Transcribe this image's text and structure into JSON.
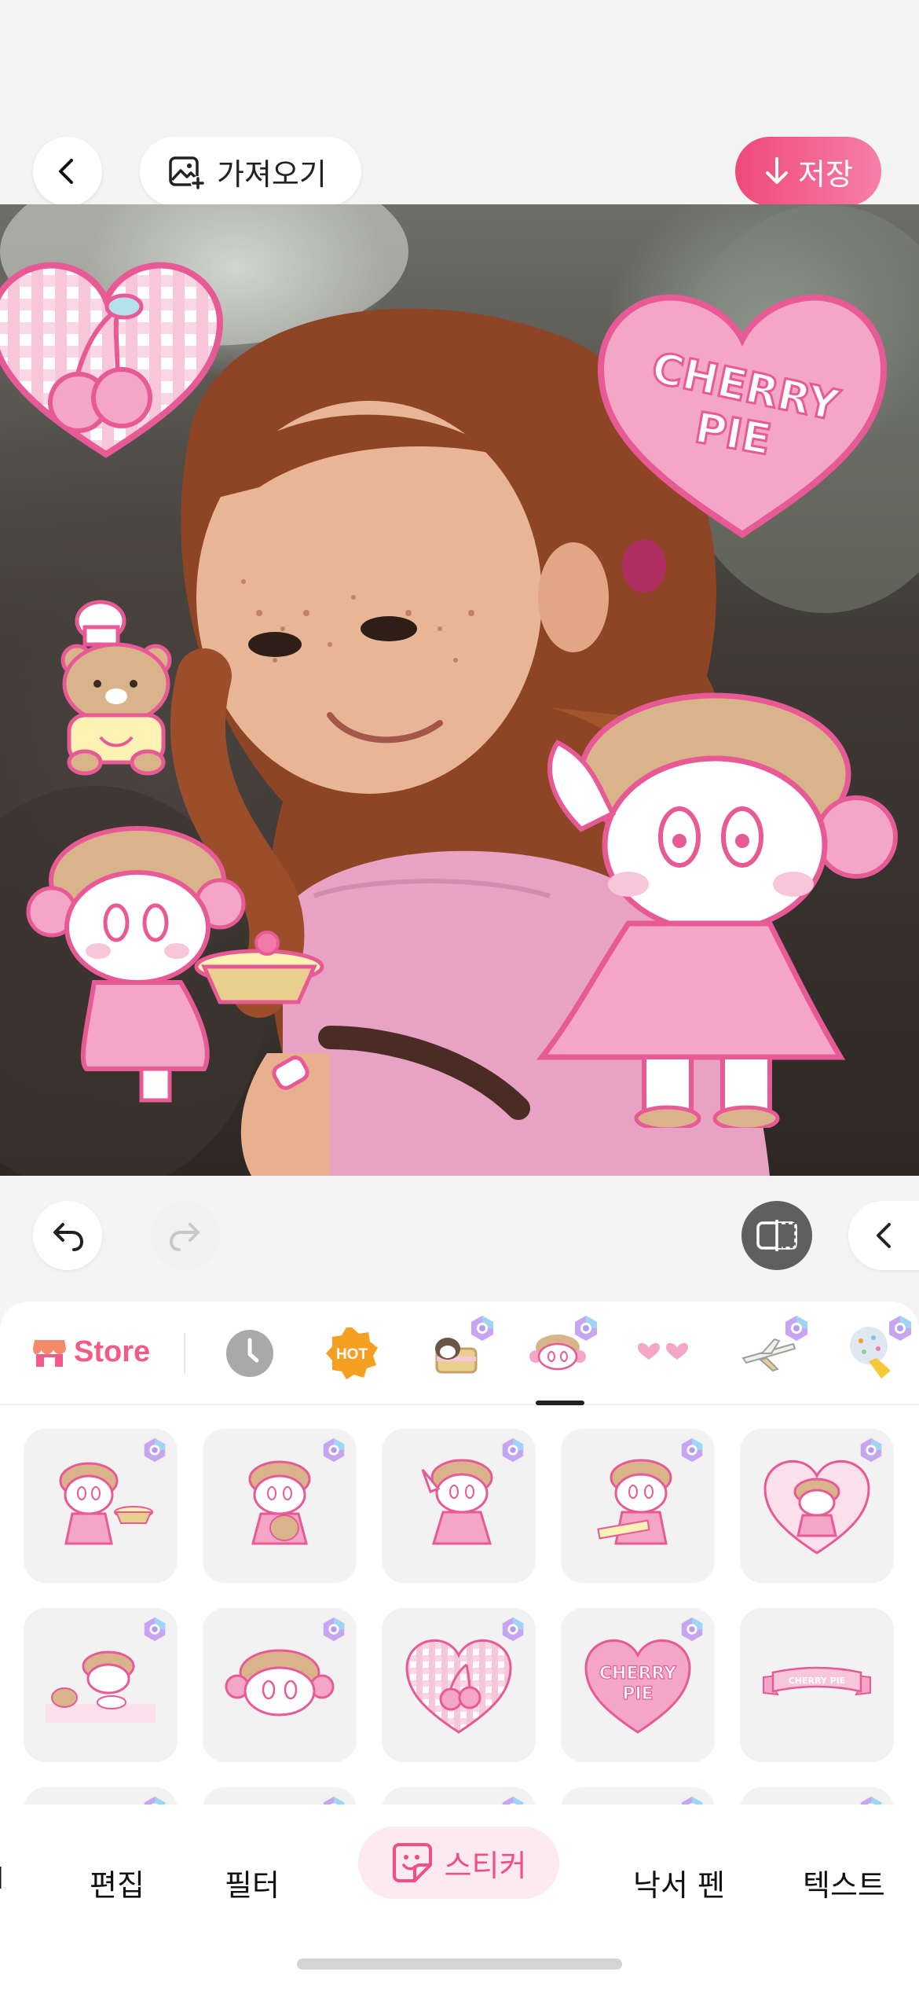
{
  "header": {
    "import_label": "가져오기",
    "save_label": "저장"
  },
  "canvas": {
    "stickers": {
      "cherry_pie_text_line1": "CHERRY",
      "cherry_pie_text_line2": "PIE"
    }
  },
  "colors": {
    "accent_pink": "#f0487a",
    "sticker_pink": "#f4a6c6",
    "sticker_outline": "#e85a96"
  },
  "panel": {
    "store_label": "Store",
    "categories": [
      {
        "name": "recent",
        "icon": "clock-icon"
      },
      {
        "name": "hot",
        "label": "HOT",
        "icon": "hot-badge-icon"
      },
      {
        "name": "cat-cake-pack",
        "icon": "cat-cake-icon"
      },
      {
        "name": "cherry-girl-pack",
        "icon": "girl-face-icon",
        "selected": true
      },
      {
        "name": "hearts-pack",
        "icon": "hearts-icon"
      },
      {
        "name": "airplane-pack",
        "icon": "airplane-icon"
      },
      {
        "name": "icecream-pack",
        "icon": "icecream-icon"
      }
    ],
    "stickers": [
      {
        "name": "girl-holding-pie"
      },
      {
        "name": "girl-holding-bear"
      },
      {
        "name": "girl-waving"
      },
      {
        "name": "girl-with-tray"
      },
      {
        "name": "girl-in-heart"
      },
      {
        "name": "girl-baking-scene"
      },
      {
        "name": "girl-face"
      },
      {
        "name": "cherry-heart"
      },
      {
        "name": "cherry-pie-heart",
        "text_line1": "CHERRY",
        "text_line2": "PIE"
      },
      {
        "name": "cherry-pie-ribbon",
        "text": "CHERRY PIE"
      }
    ]
  },
  "bottom_nav": {
    "partial_left_label": "I",
    "items": [
      "편집",
      "필터",
      "스티커",
      "낙서 펜",
      "텍스트"
    ],
    "active": "스티커"
  }
}
